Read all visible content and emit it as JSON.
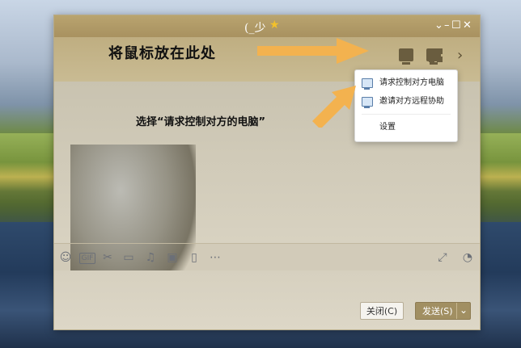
{
  "window": {
    "title": "(_少",
    "title_star_icon": "star-icon",
    "controls": [
      "chevron-down-icon",
      "minimize-icon",
      "maximize-icon",
      "close-icon"
    ]
  },
  "toolbar": {
    "icons": [
      "screen-share-icon",
      "remote-assist-icon",
      "apps-grid-icon",
      "chevron-right-icon"
    ]
  },
  "menu": {
    "items": [
      {
        "label": "请求控制对方电脑",
        "icon": "remote-control-icon"
      },
      {
        "label": "邀请对方远程协助",
        "icon": "remote-assist-icon"
      },
      {
        "label": "设置",
        "icon": ""
      }
    ]
  },
  "annotations": {
    "hover_hint": "将鼠标放在此处",
    "select_hint": "选择“请求控制对方的电脑”"
  },
  "input_toolbar": {
    "icons": [
      "emoji-icon",
      "gif-icon",
      "scissors-icon",
      "folder-icon",
      "music-icon",
      "image-icon",
      "phone-icon",
      "more-icon",
      "expand-icon",
      "clock-icon"
    ]
  },
  "buttons": {
    "close": "关闭(C)",
    "send": "发送(S)"
  }
}
